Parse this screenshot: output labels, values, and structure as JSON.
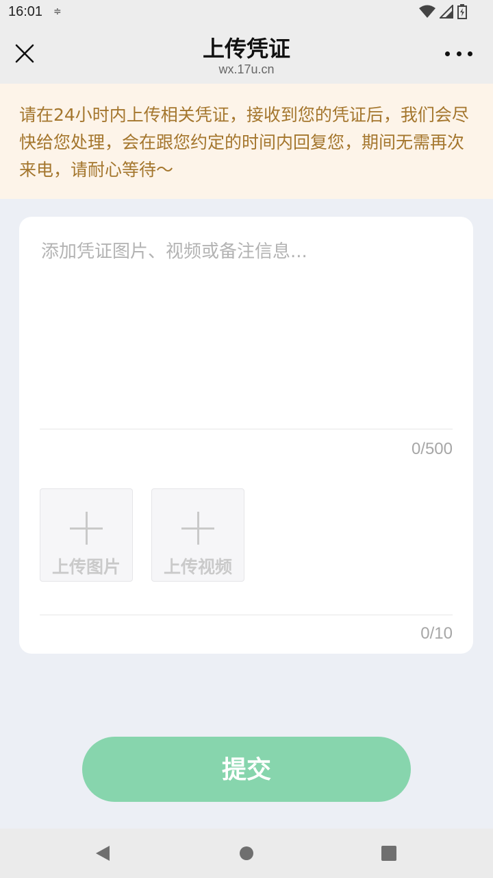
{
  "status_bar": {
    "time": "16:01",
    "extra_icon": "≑",
    "wifi_icon": "wifi-icon",
    "signal_icon": "signal-icon",
    "battery_icon": "battery-charging-icon"
  },
  "nav": {
    "title": "上传凭证",
    "subtitle": "wx.17u.cn",
    "close_icon": "close-icon",
    "more_icon": "more-icon"
  },
  "notice": {
    "text": "请在24小时内上传相关凭证，接收到您的凭证后，我们会尽快给您处理，会在跟您约定的时间内回复您，期间无需再次来电，请耐心等待～"
  },
  "form": {
    "remark_placeholder": "添加凭证图片、视频或备注信息...",
    "remark_value": "",
    "text_counter": "0/500",
    "upload_image_label": "上传图片",
    "upload_video_label": "上传视频",
    "media_counter": "0/10"
  },
  "submit_label": "提交",
  "colors": {
    "notice_text": "#a4762d",
    "notice_bg": "#fdf4e9",
    "submit_bg": "#87d5ad",
    "page_bg": "#eceff5"
  }
}
